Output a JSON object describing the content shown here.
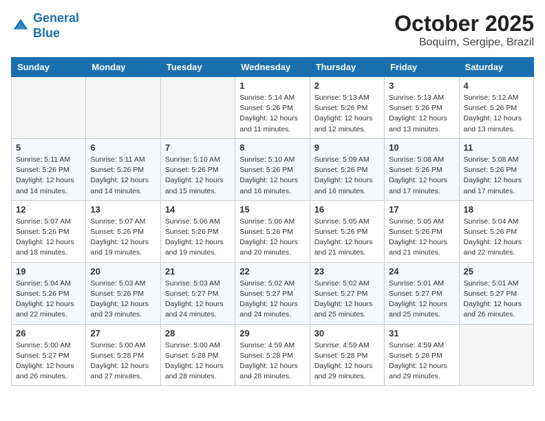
{
  "header": {
    "logo_line1": "General",
    "logo_line2": "Blue",
    "month": "October 2025",
    "location": "Boquim, Sergipe, Brazil"
  },
  "weekdays": [
    "Sunday",
    "Monday",
    "Tuesday",
    "Wednesday",
    "Thursday",
    "Friday",
    "Saturday"
  ],
  "weeks": [
    [
      {
        "day": "",
        "info": ""
      },
      {
        "day": "",
        "info": ""
      },
      {
        "day": "",
        "info": ""
      },
      {
        "day": "1",
        "info": "Sunrise: 5:14 AM\nSunset: 5:26 PM\nDaylight: 12 hours\nand 11 minutes."
      },
      {
        "day": "2",
        "info": "Sunrise: 5:13 AM\nSunset: 5:26 PM\nDaylight: 12 hours\nand 12 minutes."
      },
      {
        "day": "3",
        "info": "Sunrise: 5:13 AM\nSunset: 5:26 PM\nDaylight: 12 hours\nand 13 minutes."
      },
      {
        "day": "4",
        "info": "Sunrise: 5:12 AM\nSunset: 5:26 PM\nDaylight: 12 hours\nand 13 minutes."
      }
    ],
    [
      {
        "day": "5",
        "info": "Sunrise: 5:11 AM\nSunset: 5:26 PM\nDaylight: 12 hours\nand 14 minutes."
      },
      {
        "day": "6",
        "info": "Sunrise: 5:11 AM\nSunset: 5:26 PM\nDaylight: 12 hours\nand 14 minutes."
      },
      {
        "day": "7",
        "info": "Sunrise: 5:10 AM\nSunset: 5:26 PM\nDaylight: 12 hours\nand 15 minutes."
      },
      {
        "day": "8",
        "info": "Sunrise: 5:10 AM\nSunset: 5:26 PM\nDaylight: 12 hours\nand 16 minutes."
      },
      {
        "day": "9",
        "info": "Sunrise: 5:09 AM\nSunset: 5:26 PM\nDaylight: 12 hours\nand 16 minutes."
      },
      {
        "day": "10",
        "info": "Sunrise: 5:08 AM\nSunset: 5:26 PM\nDaylight: 12 hours\nand 17 minutes."
      },
      {
        "day": "11",
        "info": "Sunrise: 5:08 AM\nSunset: 5:26 PM\nDaylight: 12 hours\nand 17 minutes."
      }
    ],
    [
      {
        "day": "12",
        "info": "Sunrise: 5:07 AM\nSunset: 5:26 PM\nDaylight: 12 hours\nand 18 minutes."
      },
      {
        "day": "13",
        "info": "Sunrise: 5:07 AM\nSunset: 5:26 PM\nDaylight: 12 hours\nand 19 minutes."
      },
      {
        "day": "14",
        "info": "Sunrise: 5:06 AM\nSunset: 5:26 PM\nDaylight: 12 hours\nand 19 minutes."
      },
      {
        "day": "15",
        "info": "Sunrise: 5:06 AM\nSunset: 5:26 PM\nDaylight: 12 hours\nand 20 minutes."
      },
      {
        "day": "16",
        "info": "Sunrise: 5:05 AM\nSunset: 5:26 PM\nDaylight: 12 hours\nand 21 minutes."
      },
      {
        "day": "17",
        "info": "Sunrise: 5:05 AM\nSunset: 5:26 PM\nDaylight: 12 hours\nand 21 minutes."
      },
      {
        "day": "18",
        "info": "Sunrise: 5:04 AM\nSunset: 5:26 PM\nDaylight: 12 hours\nand 22 minutes."
      }
    ],
    [
      {
        "day": "19",
        "info": "Sunrise: 5:04 AM\nSunset: 5:26 PM\nDaylight: 12 hours\nand 22 minutes."
      },
      {
        "day": "20",
        "info": "Sunrise: 5:03 AM\nSunset: 5:26 PM\nDaylight: 12 hours\nand 23 minutes."
      },
      {
        "day": "21",
        "info": "Sunrise: 5:03 AM\nSunset: 5:27 PM\nDaylight: 12 hours\nand 24 minutes."
      },
      {
        "day": "22",
        "info": "Sunrise: 5:02 AM\nSunset: 5:27 PM\nDaylight: 12 hours\nand 24 minutes."
      },
      {
        "day": "23",
        "info": "Sunrise: 5:02 AM\nSunset: 5:27 PM\nDaylight: 12 hours\nand 25 minutes."
      },
      {
        "day": "24",
        "info": "Sunrise: 5:01 AM\nSunset: 5:27 PM\nDaylight: 12 hours\nand 25 minutes."
      },
      {
        "day": "25",
        "info": "Sunrise: 5:01 AM\nSunset: 5:27 PM\nDaylight: 12 hours\nand 26 minutes."
      }
    ],
    [
      {
        "day": "26",
        "info": "Sunrise: 5:00 AM\nSunset: 5:27 PM\nDaylight: 12 hours\nand 26 minutes."
      },
      {
        "day": "27",
        "info": "Sunrise: 5:00 AM\nSunset: 5:28 PM\nDaylight: 12 hours\nand 27 minutes."
      },
      {
        "day": "28",
        "info": "Sunrise: 5:00 AM\nSunset: 5:28 PM\nDaylight: 12 hours\nand 28 minutes."
      },
      {
        "day": "29",
        "info": "Sunrise: 4:59 AM\nSunset: 5:28 PM\nDaylight: 12 hours\nand 28 minutes."
      },
      {
        "day": "30",
        "info": "Sunrise: 4:59 AM\nSunset: 5:28 PM\nDaylight: 12 hours\nand 29 minutes."
      },
      {
        "day": "31",
        "info": "Sunrise: 4:59 AM\nSunset: 5:28 PM\nDaylight: 12 hours\nand 29 minutes."
      },
      {
        "day": "",
        "info": ""
      }
    ]
  ]
}
